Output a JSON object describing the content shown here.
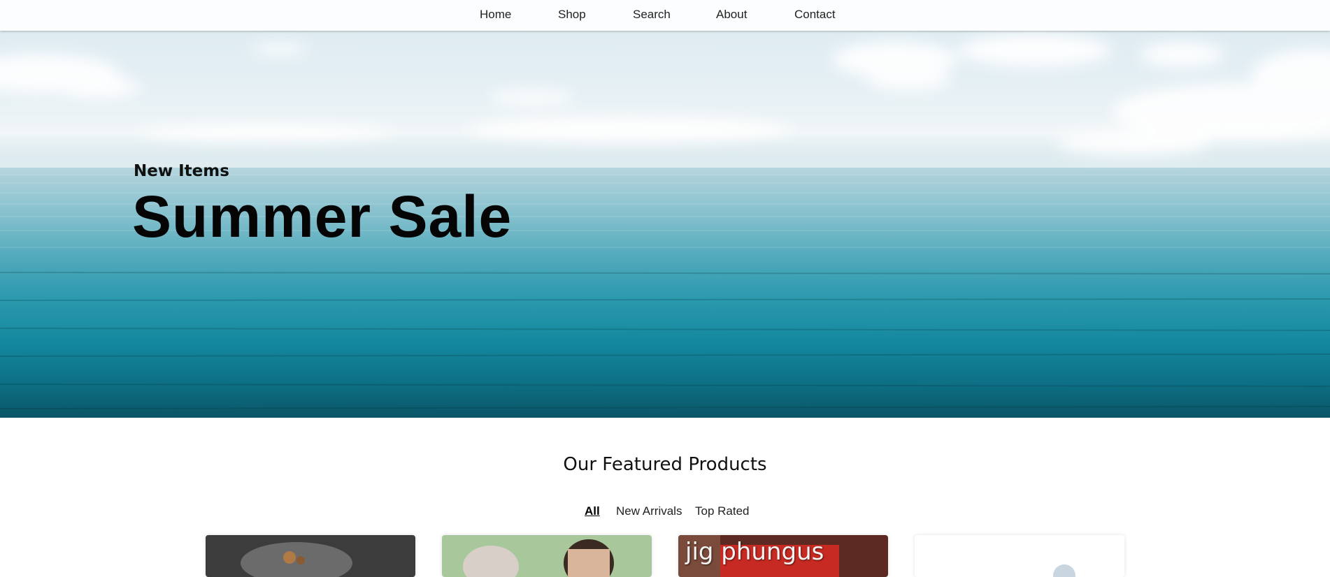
{
  "nav": {
    "items": [
      {
        "label": "Home"
      },
      {
        "label": "Shop"
      },
      {
        "label": "Search"
      },
      {
        "label": "About"
      },
      {
        "label": "Contact"
      }
    ]
  },
  "hero": {
    "kicker": "New Items",
    "title": "Summer Sale"
  },
  "featured": {
    "title": "Our Featured Products",
    "tabs": [
      {
        "label": "All",
        "active": true
      },
      {
        "label": "New Arrivals",
        "active": false
      },
      {
        "label": "Top Rated",
        "active": false
      }
    ],
    "cards": [
      {
        "caption": ""
      },
      {
        "caption": ""
      },
      {
        "caption": "jig phungus"
      },
      {
        "caption": ""
      }
    ]
  },
  "colors": {
    "accent_text": "#111111",
    "sky": "#e4eff4",
    "sea": "#14889f"
  }
}
